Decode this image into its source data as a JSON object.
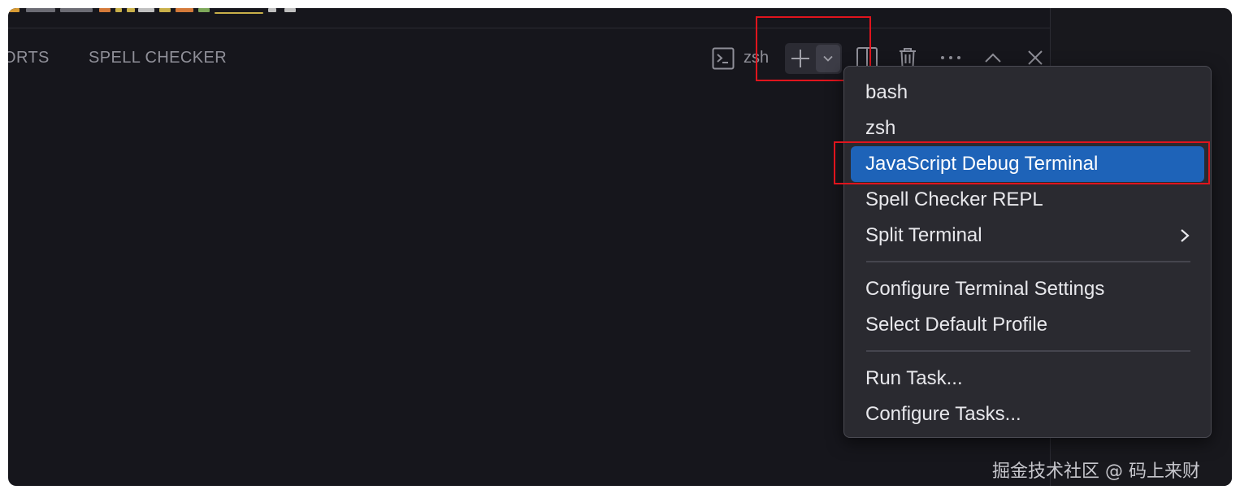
{
  "panel": {
    "tabs": [
      {
        "label": "ORTS"
      },
      {
        "label": "SPELL CHECKER"
      }
    ],
    "terminal_name": "zsh"
  },
  "toolbar_icons": {
    "terminal": "terminal-icon",
    "add": "plus-icon",
    "profiles": "chevron-down-icon",
    "split": "split-icon",
    "kill": "trash-icon",
    "more": "ellipsis-icon",
    "maximize": "chevron-up-icon",
    "close": "close-icon"
  },
  "menu": {
    "group1": [
      {
        "label": "bash",
        "active": false
      },
      {
        "label": "zsh",
        "active": false
      },
      {
        "label": "JavaScript Debug Terminal",
        "active": true
      },
      {
        "label": "Spell Checker REPL",
        "active": false
      },
      {
        "label": "Split Terminal",
        "active": false,
        "submenu": true
      }
    ],
    "group2": [
      {
        "label": "Configure Terminal Settings"
      },
      {
        "label": "Select Default Profile"
      }
    ],
    "group3": [
      {
        "label": "Run Task..."
      },
      {
        "label": "Configure Tasks..."
      }
    ]
  },
  "watermark": "掘金技术社区 @ 码上来财",
  "colors": {
    "background": "#16161c",
    "menu_background": "#2a2a30",
    "menu_active": "#1e63b8",
    "annotation_red": "#e0141d",
    "text_muted": "#8f8f98"
  }
}
